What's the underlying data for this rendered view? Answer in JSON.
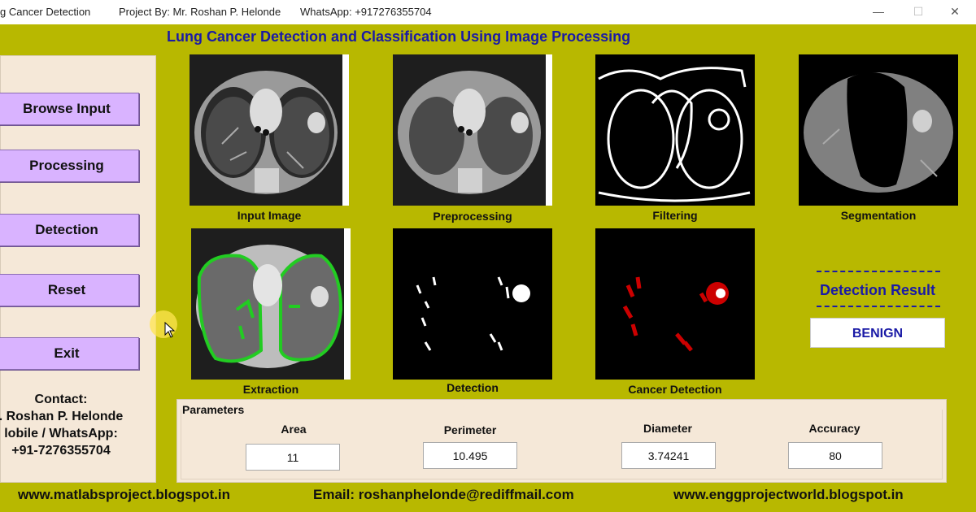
{
  "titlebar": {
    "app_name": "g Cancer Detection",
    "project_by": "Project By: Mr. Roshan P. Helonde",
    "whatsapp": "WhatsApp: +917276355704",
    "minimize": "—",
    "maximize": "☐",
    "close": "✕"
  },
  "app_title": "Lung Cancer Detection and Classification Using Image Processing",
  "buttons": {
    "browse": "Browse Input",
    "processing": "Processing",
    "detection": "Detection",
    "reset": "Reset",
    "exit": "Exit"
  },
  "contact": {
    "heading": "Contact:",
    "name": ". Roshan P. Helonde",
    "mobile_label": "lobile / WhatsApp:",
    "phone": "+91-7276355704"
  },
  "images": {
    "input": "Input Image",
    "preprocessing": "Preprocessing",
    "filtering": "Filtering",
    "segmentation": "Segmentation",
    "extraction": "Extraction",
    "detection": "Detection",
    "cancer_detection": "Cancer Detection"
  },
  "result": {
    "label": "Detection Result",
    "value": "BENIGN"
  },
  "parameters": {
    "legend": "Parameters",
    "area_label": "Area",
    "area_value": "11",
    "perimeter_label": "Perimeter",
    "perimeter_value": "10.495",
    "diameter_label": "Diameter",
    "diameter_value": "3.74241",
    "accuracy_label": "Accuracy",
    "accuracy_value": "80"
  },
  "footer": {
    "blog": "www.matlabsproject.blogspot.in",
    "email": "Email: roshanphelonde@rediffmail.com",
    "site": "www.enggprojectworld.blogspot.in"
  },
  "colors": {
    "background": "#b8b800",
    "title_blue": "#1a1aa6",
    "button": "#d9b3ff",
    "panel": "#f5e8d8",
    "contour_green": "#22cc22",
    "cancer_red": "#cc0000"
  }
}
